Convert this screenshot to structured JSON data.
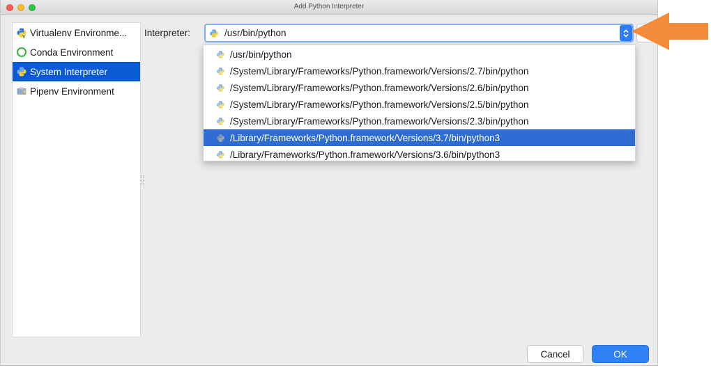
{
  "window": {
    "title": "Add Python Interpreter"
  },
  "sidebar": {
    "items": [
      {
        "label": "Virtualenv Environme...",
        "icon": "virtualenv-icon",
        "selected": false
      },
      {
        "label": "Conda Environment",
        "icon": "conda-icon",
        "selected": false
      },
      {
        "label": "System Interpreter",
        "icon": "python-icon",
        "selected": true
      },
      {
        "label": "Pipenv Environment",
        "icon": "pipenv-icon",
        "selected": false
      }
    ]
  },
  "interpreter": {
    "label": "Interpreter:",
    "value": "/usr/bin/python",
    "options": [
      "/usr/bin/python",
      "/System/Library/Frameworks/Python.framework/Versions/2.7/bin/python",
      "/System/Library/Frameworks/Python.framework/Versions/2.6/bin/python",
      "/System/Library/Frameworks/Python.framework/Versions/2.5/bin/python",
      "/System/Library/Frameworks/Python.framework/Versions/2.3/bin/python",
      "/Library/Frameworks/Python.framework/Versions/3.7/bin/python3",
      "/Library/Frameworks/Python.framework/Versions/3.6/bin/python3"
    ],
    "highlighted_index": 5
  },
  "buttons": {
    "cancel": "Cancel",
    "ok": "OK"
  },
  "colors": {
    "accent": "#2d7cf6",
    "selection": "#0a5bd3",
    "arrow": "#f28c3a"
  }
}
